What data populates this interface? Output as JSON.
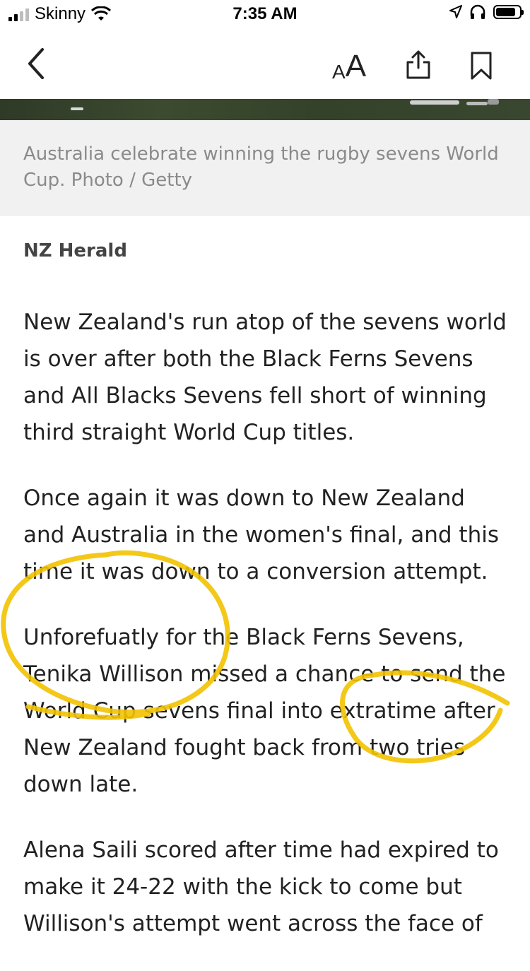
{
  "status_bar": {
    "carrier": "Skinny",
    "time": "7:35 AM",
    "battery_level": 0.85,
    "icons": [
      "signal-icon",
      "wifi-icon",
      "location-icon",
      "headphones-icon",
      "battery-icon"
    ]
  },
  "nav": {
    "back_icon": "chevron-left-icon",
    "font_size_small": "A",
    "font_size_large": "A",
    "share_icon": "share-icon",
    "bookmark_icon": "bookmark-icon"
  },
  "caption": "Australia celebrate winning the rugby sevens World Cup. Photo / Getty",
  "source": "NZ Herald",
  "article": {
    "paragraphs": [
      "New Zealand's run atop of the sevens world is over after both the Black Ferns Sevens and All Blacks Sevens fell short of winning third straight World Cup titles.",
      "Once again it was down to New Zealand and Australia in the women's final, and this time it was down to a conversion attempt.",
      "Unforefuatly for the Black Ferns Sevens, Tenika Willison missed a chance to send the World Cup sevens final into extratime after New Zealand fought back from two tries down late.",
      "Alena Saili scored after time had expired to make it 24-22 with the kick to come but Willison's attempt went across the face of"
    ]
  },
  "colors": {
    "text": "#222222",
    "caption_text": "#8a8a8a",
    "caption_bg": "#f1f1f1",
    "annotation": "#f2c200"
  },
  "annotation": {
    "type": "highlighter-circles",
    "count": 2
  }
}
